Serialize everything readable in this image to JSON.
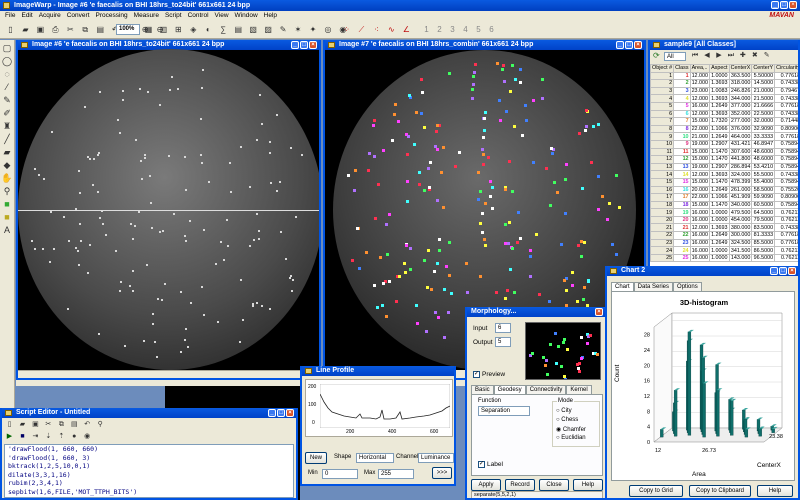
{
  "app": {
    "title": "ImageWarp - Image #6 'e faecalis on BHI 18hrs_to24bit' 661x661 24 bpp",
    "brand": "MAVAN",
    "menu": [
      "File",
      "Edit",
      "Acquire",
      "Convert",
      "Processing",
      "Measure",
      "Script",
      "Control",
      "View",
      "Window",
      "Help"
    ],
    "zoom": "100%",
    "step_numbers": [
      "1",
      "2",
      "3",
      "4",
      "5",
      "6"
    ]
  },
  "image6": {
    "title": "Image #6 'e faecalis on BHI 18hrs_to24bit' 661x661 24 bpp"
  },
  "image7": {
    "title": "Image #7 'e faecalis on BHI 18hrs_combin' 661x661 24 bpp"
  },
  "sample": {
    "title": "sample9 [All Classes]",
    "filter": "All",
    "columns": [
      "Object #",
      "Class",
      "Area,..",
      "Aspect",
      "CenterX",
      "CenterY",
      "Circularity",
      "D"
    ],
    "rows": [
      [
        "1",
        "1",
        "12.000",
        "1.0000",
        "363.500",
        "5.50000",
        "0.77618",
        "4"
      ],
      [
        "2",
        "2",
        "12.000",
        "1.3693",
        "318.000",
        "14.5000",
        "0.74338",
        "3"
      ],
      [
        "3",
        "3",
        "23.000",
        "1.0083",
        "246.826",
        "21.0000",
        "0.79467",
        "5"
      ],
      [
        "4",
        "4",
        "12.000",
        "1.3693",
        "344.000",
        "21.5000",
        "0.74338",
        "3"
      ],
      [
        "5",
        "5",
        "16.000",
        "1.2649",
        "377.000",
        "21.6666",
        "0.77618",
        "4"
      ],
      [
        "6",
        "6",
        "12.000",
        "1.3693",
        "352.000",
        "22.5000",
        "0.74338",
        "3"
      ],
      [
        "7",
        "7",
        "15.000",
        "1.7320",
        "277.000",
        "32.0000",
        "0.71448",
        "4"
      ],
      [
        "8",
        "8",
        "22.000",
        "1.1066",
        "376.000",
        "32.9090",
        "0.80906",
        "5"
      ],
      [
        "9",
        "10",
        "21.000",
        "1.2649",
        "464.000",
        "33.3333",
        "0.77618",
        "5"
      ],
      [
        "10",
        "9",
        "19.000",
        "1.2907",
        "431.421",
        "46.8947",
        "0.75894",
        "4"
      ],
      [
        "11",
        "11",
        "15.000",
        "1.1470",
        "307.600",
        "48.6000",
        "0.75894",
        "4"
      ],
      [
        "12",
        "12",
        "15.000",
        "1.1470",
        "441.800",
        "48.6000",
        "0.75894",
        "4"
      ],
      [
        "13",
        "13",
        "19.000",
        "1.2907",
        "286.894",
        "53.4210",
        "0.75894",
        "4"
      ],
      [
        "14",
        "14",
        "12.000",
        "1.3693",
        "324.000",
        "55.5000",
        "0.74338",
        "3"
      ],
      [
        "15",
        "15",
        "15.000",
        "1.1470",
        "478.399",
        "55.4000",
        "0.75894",
        "4"
      ],
      [
        "16",
        "16",
        "20.000",
        "1.2649",
        "261.000",
        "58.5000",
        "0.75520",
        "5"
      ],
      [
        "17",
        "17",
        "22.000",
        "1.1066",
        "451.909",
        "59.9090",
        "0.80906",
        "5"
      ],
      [
        "18",
        "18",
        "15.000",
        "1.1470",
        "340.000",
        "60.5000",
        "0.75894",
        "4"
      ],
      [
        "19",
        "19",
        "16.000",
        "1.0000",
        "479.500",
        "64.5000",
        "0.76211",
        "4"
      ],
      [
        "20",
        "20",
        "16.000",
        "1.0000",
        "454.000",
        "79.5000",
        "0.76211",
        "4"
      ],
      [
        "21",
        "21",
        "12.000",
        "1.3693",
        "380.000",
        "83.5000",
        "0.74338",
        "3"
      ],
      [
        "22",
        "22",
        "16.000",
        "1.2649",
        "300.000",
        "81.3333",
        "0.77618",
        "4"
      ],
      [
        "23",
        "23",
        "16.000",
        "1.2649",
        "324.500",
        "85.5000",
        "0.77618",
        "4"
      ],
      [
        "24",
        "24",
        "16.000",
        "1.0000",
        "341.500",
        "86.5000",
        "0.76211",
        "4"
      ],
      [
        "25",
        "25",
        "16.000",
        "1.0000",
        "143.000",
        "96.5000",
        "0.76211",
        "4"
      ]
    ]
  },
  "chart": {
    "title": "Chart 2",
    "tabs": [
      "Chart",
      "Data Series",
      "Options"
    ],
    "heading": "3D-histogram",
    "ylabel": "Count",
    "xlabel": "Area",
    "zlabel": "CenterX",
    "x_ticks": [
      "12",
      "26.73",
      "23.38"
    ],
    "y_ticks": [
      "28",
      "24",
      "20",
      "16",
      "12",
      "8",
      "4",
      "0"
    ],
    "copy_grid": "Copy to Grid",
    "copy_clipboard": "Copy to Clipboard",
    "help": "Help"
  },
  "chart_data": {
    "type": "bar",
    "title": "3D-histogram",
    "xlabel": "Area",
    "ylabel": "Count",
    "ylim": [
      0,
      30
    ],
    "values": [
      2,
      5,
      8,
      12,
      18,
      24,
      27,
      22,
      16,
      20,
      14,
      10,
      18,
      12,
      8,
      6,
      9,
      5,
      3,
      4,
      2,
      3,
      1,
      2,
      1,
      1
    ]
  },
  "morphology": {
    "title": "Morphology...",
    "input_label": "Input",
    "input_value": "6",
    "output_label": "Output",
    "output_value": "5",
    "preview": "Preview",
    "tabs": [
      "Basic",
      "Geodesy",
      "Connectivity",
      "Kernel"
    ],
    "function_label": "Function",
    "function_value": "Separation",
    "mode_label": "Mode",
    "modes": [
      "City",
      "Chess",
      "Chamfer",
      "Euclidian"
    ],
    "label_check": "Label",
    "apply": "Apply",
    "record": "Record",
    "close": "Close",
    "help": "Help",
    "status": "separate(5,5,2,1)"
  },
  "line_profile": {
    "title": "Line Profile",
    "y_ticks": [
      "200",
      "100",
      "0"
    ],
    "x_ticks": [
      "200",
      "400",
      "600"
    ],
    "new": "New",
    "shape_label": "Shape",
    "shape_value": "Horizontal",
    "channel_label": "Channel",
    "channel_value": "Luminance",
    "min_label": "Min",
    "min_value": "0",
    "max_label": "Max",
    "max_value": "255",
    "arrows": ">>>"
  },
  "script_editor": {
    "title": "Script Editor - Untitled",
    "lines": [
      "'drawFlood(1, 660, 660)",
      "'drawFlood(1, 660, 3)",
      "bktrack(1,2,5,10,0,1)",
      "dilate(3,3,1,16)",
      "rubim(2,3,4,1)",
      "sepbitw(1,6,FILE,'MOT_TTPH_BITS')"
    ]
  },
  "colors": {
    "xp_blue": "#0054e3",
    "mdi_bg": "#6c8cbc",
    "teal_bar": "#0f6e6a"
  }
}
